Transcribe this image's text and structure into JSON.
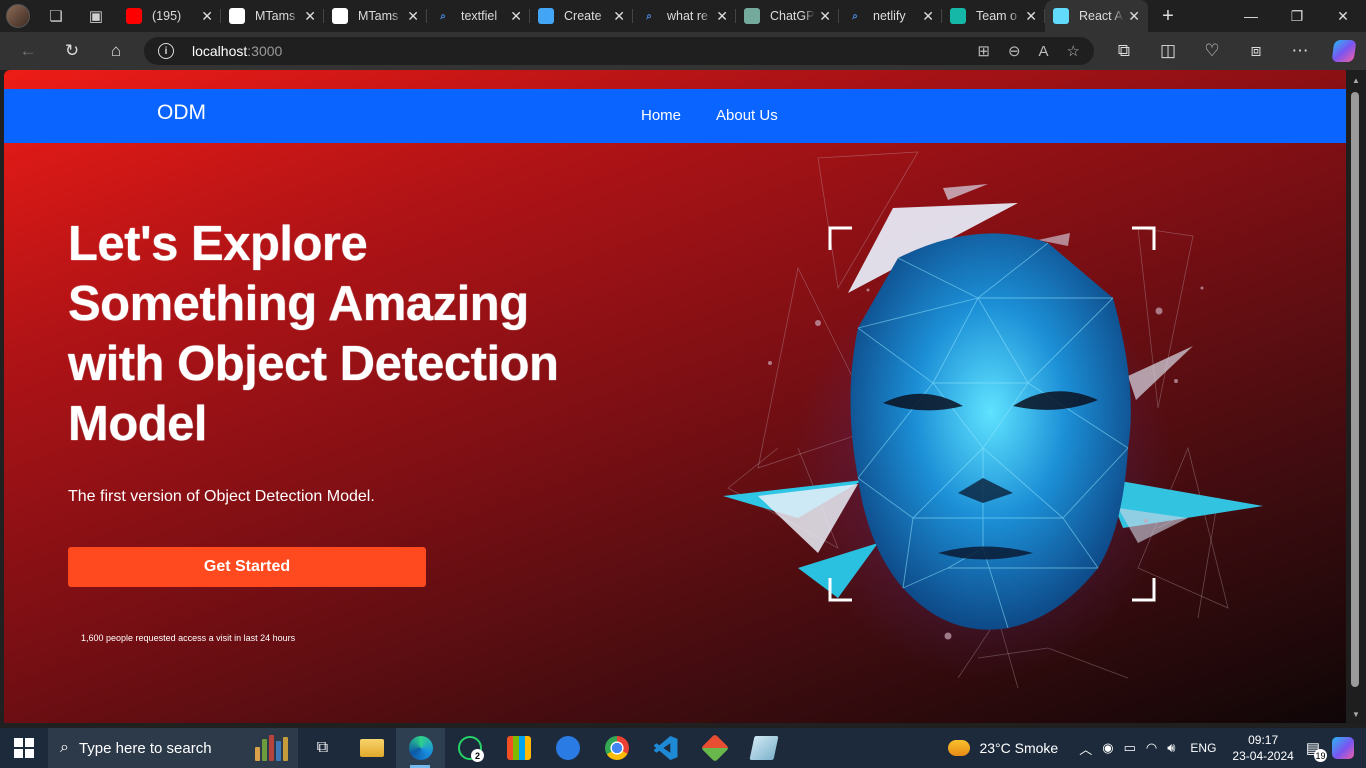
{
  "browser": {
    "tabs": [
      {
        "title": "(195)",
        "icon": "youtube-icon",
        "color": "#ff0000"
      },
      {
        "title": "MTams",
        "icon": "github-icon",
        "color": "#ffffff"
      },
      {
        "title": "MTams",
        "icon": "github-icon",
        "color": "#ffffff"
      },
      {
        "title": "textfiel",
        "icon": "search-icon",
        "color": "#4a8fe7"
      },
      {
        "title": "Create",
        "icon": "flutter-icon",
        "color": "#42a5f5"
      },
      {
        "title": "what re",
        "icon": "search-icon",
        "color": "#4a8fe7"
      },
      {
        "title": "ChatGP",
        "icon": "chatgpt-icon",
        "color": "#74aa9c"
      },
      {
        "title": "netlify",
        "icon": "search-icon",
        "color": "#4a8fe7"
      },
      {
        "title": "Team o",
        "icon": "netlify-icon",
        "color": "#15b8a6"
      },
      {
        "title": "React A",
        "icon": "react-icon",
        "color": "#61dafb"
      }
    ],
    "url_host": "localhost",
    "url_port": ":3000"
  },
  "page": {
    "brand": "ODM",
    "nav": {
      "home": "Home",
      "about": "About Us"
    },
    "hero": {
      "title_lines": [
        "Let's Explore",
        "Something Amazing",
        "with Object Detection",
        "Model"
      ],
      "subtitle": "The first version of Object Detection Model.",
      "cta": "Get Started",
      "social_proof": "1,600 people requested access a visit in last 24 hours"
    }
  },
  "taskbar": {
    "search_placeholder": "Type here to search",
    "whatsapp_badge": "2",
    "weather": "23°C  Smoke",
    "lang": "ENG",
    "time": "09:17",
    "date": "23-04-2024",
    "notifications": "19"
  },
  "colors": {
    "navbar": "#0a64ff",
    "cta": "#ff4a1f",
    "hero_bg_start": "#ee1c17",
    "hero_bg_end": "#0f0607"
  }
}
